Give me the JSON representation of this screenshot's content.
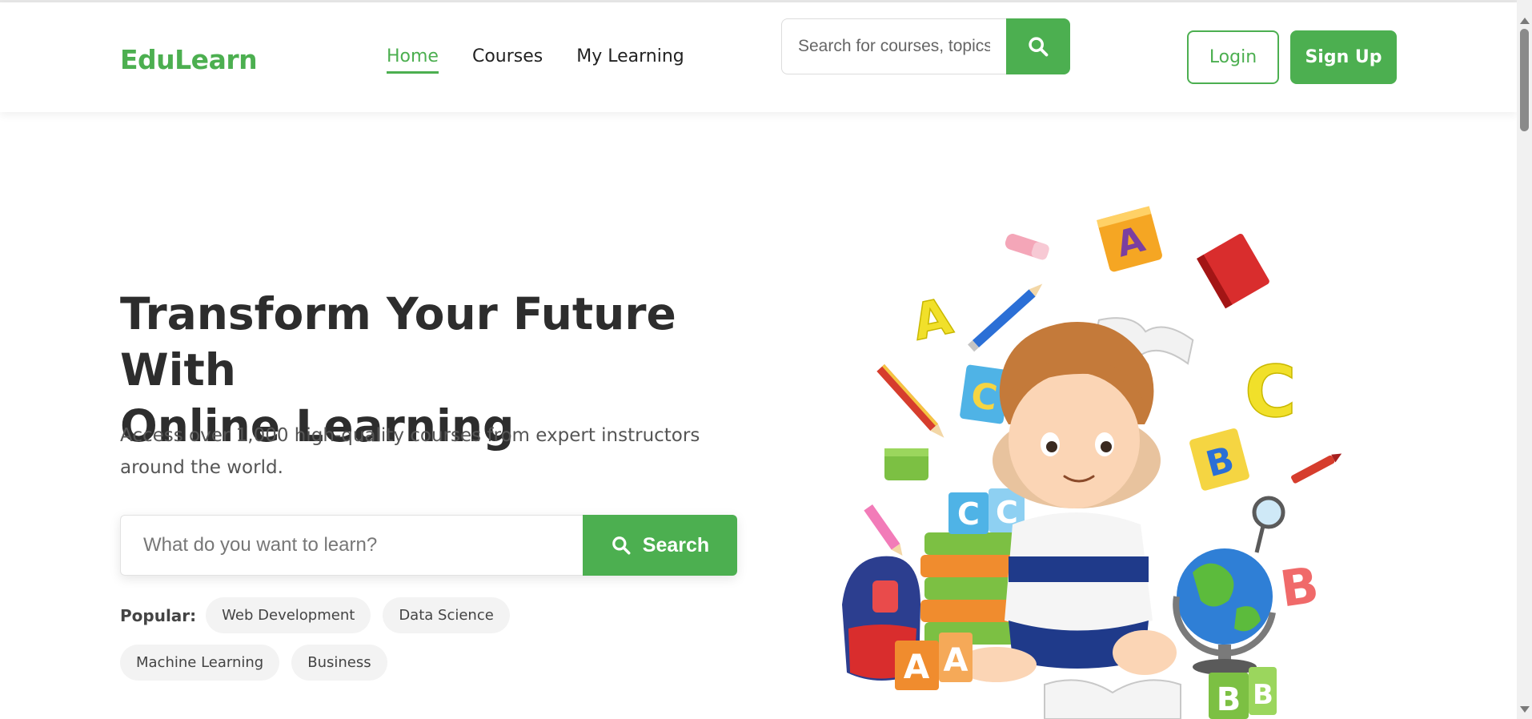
{
  "brand": {
    "name": "EduLearn",
    "accent": "#4caf50"
  },
  "nav": {
    "items": [
      {
        "label": "Home",
        "active": true
      },
      {
        "label": "Courses",
        "active": false
      },
      {
        "label": "My Learning",
        "active": false
      }
    ]
  },
  "header_search": {
    "placeholder": "Search for courses, topics, ...",
    "icon": "search-icon"
  },
  "auth": {
    "login_label": "Login",
    "signup_label": "Sign Up"
  },
  "hero": {
    "title_line1": "Transform Your Future With",
    "title_line2": "Online Learning",
    "subtitle": "Access over 1,000 high-quality courses from expert instructors around the world.",
    "search": {
      "placeholder": "What do you want to learn?",
      "button_label": "Search",
      "icon": "search-icon"
    },
    "popular_label": "Popular:",
    "popular_tags": [
      "Web Development",
      "Data Science",
      "Machine Learning",
      "Business"
    ]
  }
}
